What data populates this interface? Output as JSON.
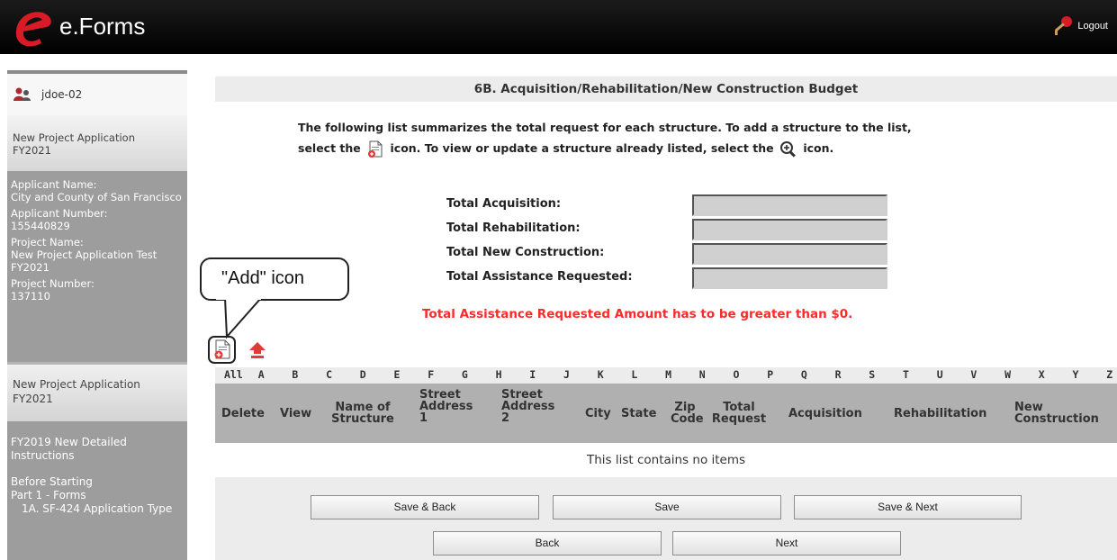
{
  "app": {
    "name": "e.Forms",
    "logout_label": "Logout"
  },
  "sidebar": {
    "user": "jdoe-02",
    "project_label": [
      "New Project Application",
      "FY2021"
    ],
    "info": [
      {
        "label": "Applicant Name:",
        "value": "City and County of San Francisco"
      },
      {
        "label": "Applicant Number:",
        "value": "155440829"
      },
      {
        "label": "Project Name:",
        "value": "New Project Application Test FY2021"
      },
      {
        "label": "Project Number:",
        "value": "137110"
      }
    ],
    "application": [
      "New Project Application",
      "FY2021"
    ],
    "nav": [
      "FY2019 New Detailed Instructions",
      "Before Starting",
      "Part 1 - Forms",
      "1A. SF-424 Application Type"
    ]
  },
  "page": {
    "title": "6B. Acquisition/Rehabilitation/New Construction Budget",
    "intro_1": "The following list summarizes the total request for each structure. To add a structure to the list,",
    "intro_2a": "select the",
    "intro_2b": "icon. To view or update a structure already listed, select the",
    "intro_2c": "icon.",
    "totals": [
      {
        "label": "Total Acquisition:",
        "value": ""
      },
      {
        "label": "Total Rehabilitation:",
        "value": ""
      },
      {
        "label": "Total New Construction:",
        "value": ""
      },
      {
        "label": "Total Assistance Requested:",
        "value": ""
      }
    ],
    "warning": "Total Assistance Requested Amount has to be greater than $0.",
    "callout": "\"Add\" icon"
  },
  "icons": {
    "add": "add-document-icon",
    "upload": "upload-icon",
    "view": "magnifier-icon",
    "user": "user-icon",
    "logout": "logout-key-icon"
  },
  "alpha": [
    "All",
    "A",
    "B",
    "C",
    "D",
    "E",
    "F",
    "G",
    "H",
    "I",
    "J",
    "K",
    "L",
    "M",
    "N",
    "O",
    "P",
    "Q",
    "R",
    "S",
    "T",
    "U",
    "V",
    "W",
    "X",
    "Y",
    "Z"
  ],
  "table": {
    "columns": [
      [
        "Delete"
      ],
      [
        "View"
      ],
      [
        "Name of",
        "Structure"
      ],
      [
        "Street",
        "Address",
        "1"
      ],
      [
        "Street",
        "Address",
        "2"
      ],
      [
        "City"
      ],
      [
        "State"
      ],
      [
        "Zip",
        "Code"
      ],
      [
        "Total",
        "Request"
      ],
      [
        "Acquisition"
      ],
      [
        "Rehabilitation"
      ],
      [
        "New",
        "Construction"
      ]
    ],
    "empty": "This list contains no items"
  },
  "buttons": {
    "save_back": "Save & Back",
    "save": "Save",
    "save_next": "Save & Next",
    "back": "Back",
    "next": "Next"
  },
  "colors": {
    "warning": "#ff2a2a",
    "logo": "#d81b27"
  }
}
